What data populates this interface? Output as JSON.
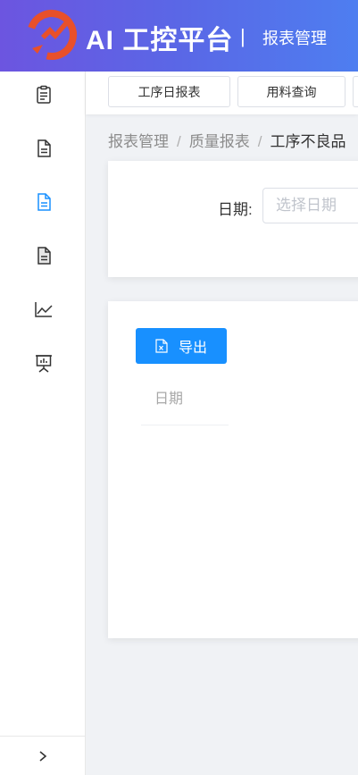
{
  "header": {
    "app_title": "AI 工控平台",
    "separator": "|",
    "section": "报表管理"
  },
  "sidebar": {
    "items": [
      {
        "icon": "clipboard-icon"
      },
      {
        "icon": "document-icon"
      },
      {
        "icon": "document-active-icon"
      },
      {
        "icon": "document-filled-icon"
      },
      {
        "icon": "line-chart-icon"
      },
      {
        "icon": "presentation-icon"
      }
    ],
    "collapse_icon": "chevron-right-icon"
  },
  "tabs": [
    {
      "label": "工序日报表"
    },
    {
      "label": "用料查询"
    }
  ],
  "breadcrumb": {
    "items": [
      "报表管理",
      "质量报表",
      "工序不良品"
    ]
  },
  "filter": {
    "date_label": "日期:",
    "date_placeholder": "选择日期"
  },
  "toolbar": {
    "export_label": "导出"
  },
  "table": {
    "columns": [
      "日期"
    ]
  },
  "colors": {
    "accent": "#1890ff",
    "header_gradient_start": "#6c55e0",
    "header_gradient_end": "#4e7ef0"
  }
}
